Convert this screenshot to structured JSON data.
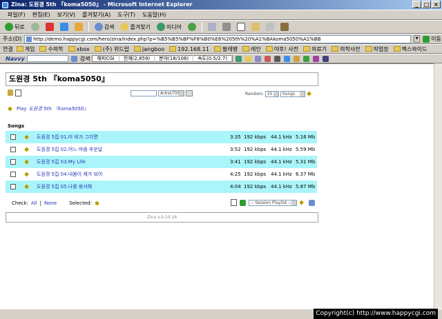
{
  "window": {
    "title": "Zina: 도원경 5th 『koma5050』 - Microsoft Internet Explorer"
  },
  "menu": [
    "파일(F)",
    "편집(E)",
    "보기(V)",
    "즐겨찾기(A)",
    "도구(T)",
    "도움말(H)"
  ],
  "toolbar": {
    "back": "뒤로",
    "search": "검색",
    "favorites": "즐겨찾기",
    "media": "미디어"
  },
  "address": {
    "label": "주소(D)",
    "url": "http://demo.happycgi.com/hero/zina/index.php?p=%B5%B5%BF%F8%B0%E6%205th%20%A1%BAkoma5050%A1%BB",
    "go": "이동"
  },
  "links": {
    "label": "연결",
    "items": [
      "게임",
      "수의학",
      "xbox",
      "(주) 위드랍",
      "jangboo",
      "192.168.11",
      "팔레뱅",
      "레인",
      "야후! 사전",
      "의료기",
      "의학사전",
      "작업장",
      "펙스와이드"
    ]
  },
  "navvy": {
    "label": "Navvy",
    "search": "검색",
    "stats": [
      "해피CGI",
      "전체(2,859)",
      "분야(18/108)",
      "속도(0.5/2.7)"
    ]
  },
  "page": {
    "title": "도원경 5th 『koma5050』",
    "search_select": "Artist/Title",
    "random_label": "Random:",
    "random_count": "25",
    "random_type": "Songs",
    "play_prefix": "Play",
    "play_name": "도원경 5th 『koma5050』",
    "songs_heading": "Songs",
    "songs": [
      {
        "title": "도원경 5집 01.미 비가 그치면",
        "duration": "3:35",
        "bitrate": "192 kbps",
        "freq": "44.1 kHz",
        "size": "5.16 Mb"
      },
      {
        "title": "도원경 5집 02.어느 마음 추운날",
        "duration": "3:52",
        "bitrate": "192 kbps",
        "freq": "44.1 kHz",
        "size": "5.59 Mb"
      },
      {
        "title": "도원경 5집 03.My Life",
        "duration": "3:41",
        "bitrate": "192 kbps",
        "freq": "44.1 kHz",
        "size": "5.31 Mb"
      },
      {
        "title": "도원경 5집 04.내몸이 재가 되어",
        "duration": "4:25",
        "bitrate": "192 kbps",
        "freq": "44.1 kHz",
        "size": "6.37 Mb"
      },
      {
        "title": "도원경 5집 05.나를 용서해",
        "duration": "4:04",
        "bitrate": "192 kbps",
        "freq": "44.1 kHz",
        "size": "5.87 Mb"
      }
    ],
    "check_label": "Check:",
    "check_all": "All",
    "check_none": "None",
    "selected_label": "Selected:",
    "playlist_select": "-- Session Playlist --",
    "footer": "Zina v.0.10.16"
  },
  "copyright": "Copyright(c) http://www.happycgi.com"
}
